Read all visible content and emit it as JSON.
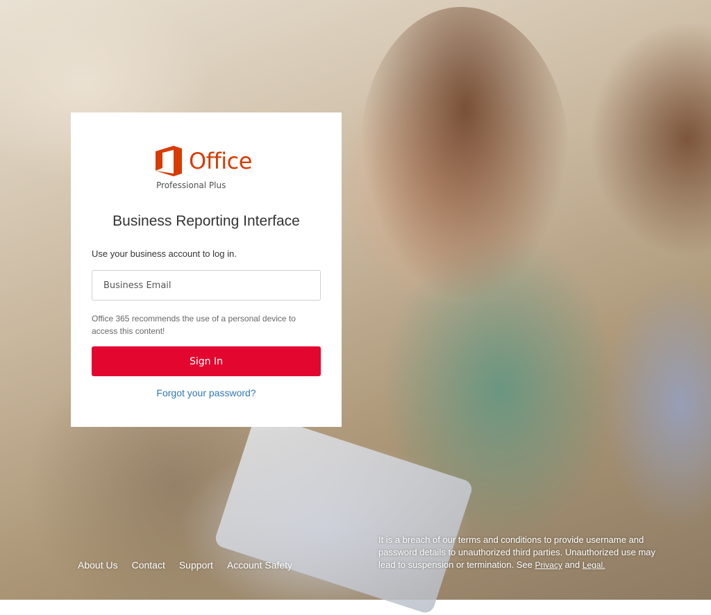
{
  "logo": {
    "word": "Office",
    "subtitle": "Professional Plus"
  },
  "card": {
    "title": "Business Reporting Interface",
    "instruction": "Use your business account to log in.",
    "email_placeholder": "Business Email",
    "note": "Office 365 recommends the use of a personal device to access this content!",
    "signin_label": "Sign In",
    "forgot_label": "Forgot your password?"
  },
  "footer": {
    "links": [
      "About Us",
      "Contact",
      "Support",
      "Account Safety"
    ]
  },
  "legal": {
    "text": "It is a breach of our terms and conditions to provide username and password details to unauthorized third parties. Unauthorized use may lead to suspension or termination. See",
    "privacy_label": "Privacy",
    "and": "and",
    "legal_label": "Legal."
  },
  "colors": {
    "accent": "#e3072f",
    "brand_orange": "#d83b01",
    "link": "#2f77b8"
  }
}
